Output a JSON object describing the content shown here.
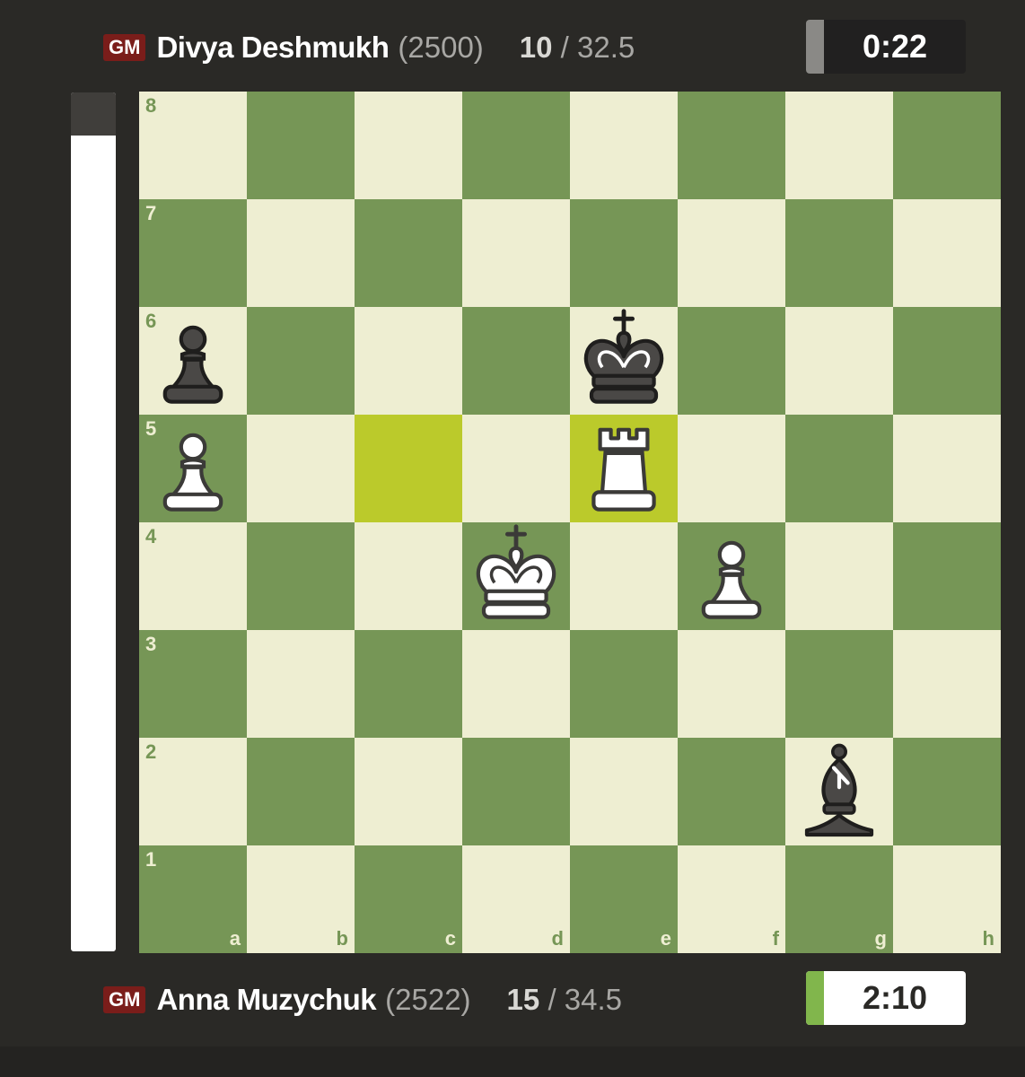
{
  "top_player": {
    "title": "GM",
    "name": "Divya Deshmukh",
    "rating": "(2500)",
    "score_main": "10",
    "score_sep": "/",
    "score_total": "32.5",
    "clock": "0:22"
  },
  "bottom_player": {
    "title": "GM",
    "name": "Anna Muzychuk",
    "rating": "(2522)",
    "score_main": "15",
    "score_sep": "/",
    "score_total": "34.5",
    "clock": "2:10"
  },
  "eval_bar": {
    "white_fraction": 0.95
  },
  "board": {
    "ranks": [
      "8",
      "7",
      "6",
      "5",
      "4",
      "3",
      "2",
      "1"
    ],
    "files": [
      "a",
      "b",
      "c",
      "d",
      "e",
      "f",
      "g",
      "h"
    ],
    "highlighted_squares": [
      "c5",
      "e5"
    ],
    "pieces": [
      {
        "square": "a6",
        "piece": "black-pawn"
      },
      {
        "square": "e6",
        "piece": "black-king"
      },
      {
        "square": "a5",
        "piece": "white-pawn"
      },
      {
        "square": "e5",
        "piece": "white-rook"
      },
      {
        "square": "d4",
        "piece": "white-king"
      },
      {
        "square": "f4",
        "piece": "white-pawn"
      },
      {
        "square": "g2",
        "piece": "black-bishop"
      }
    ]
  },
  "colors": {
    "light_square": "#eeeed2",
    "dark_square": "#769656",
    "highlight": "#bbca2b",
    "title_badge": "#7a1d1a",
    "active_clock_stripe": "#81b64c"
  }
}
